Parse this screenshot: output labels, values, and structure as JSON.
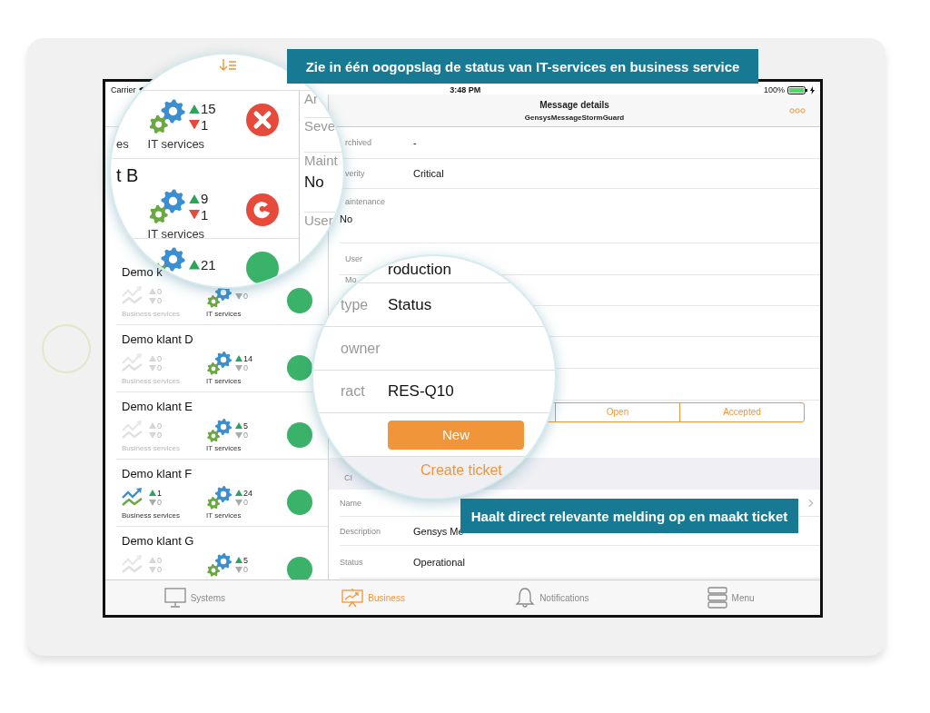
{
  "callouts": [
    "Zie in één oogopslag de status van IT-services en business service",
    "Haalt direct relevante melding op en maakt ticket"
  ],
  "status_bar": {
    "carrier": "Carrier",
    "time": "3:48 PM",
    "battery": "100%"
  },
  "clients": [
    {
      "name": "Demo k",
      "kind": "ok",
      "business": {
        "active": false,
        "up": "0",
        "down": "0",
        "down_alert": false,
        "label": "Business services"
      },
      "it": {
        "active": true,
        "down": "0",
        "down_alert": false,
        "label": "IT services"
      }
    },
    {
      "name": "Demo klant D",
      "kind": "ok",
      "business": {
        "active": false,
        "up": "0",
        "down": "0",
        "down_alert": false,
        "label": "Business services"
      },
      "it": {
        "active": true,
        "up": "14",
        "down": "0",
        "down_alert": false,
        "label": "IT services"
      }
    },
    {
      "name": "Demo klant E",
      "kind": "ok",
      "business": {
        "active": false,
        "up": "0",
        "down": "0",
        "down_alert": false,
        "label": "Business services"
      },
      "it": {
        "active": true,
        "up": "5",
        "down": "0",
        "down_alert": false,
        "label": "IT services"
      }
    },
    {
      "name": "Demo klant F",
      "kind": "ok",
      "business": {
        "active": true,
        "up": "1",
        "down": "0",
        "down_alert": false,
        "label": "Business services"
      },
      "it": {
        "active": true,
        "up": "24",
        "down": "0",
        "down_alert": false,
        "label": "IT services"
      }
    },
    {
      "name": "Demo klant G",
      "kind": "ok",
      "business": {
        "active": false,
        "up": "0",
        "down": "0",
        "down_alert": false
      },
      "it": {
        "active": true,
        "up": "5",
        "down": "0",
        "down_alert": false
      }
    }
  ],
  "detail": {
    "title": "Message details",
    "subtitle": "GensysMessageStormGuard",
    "fields": [
      {
        "kind": "inline",
        "label": "rchived",
        "value": "-"
      },
      {
        "kind": "inline",
        "label": "verity",
        "value": "Critical"
      },
      {
        "kind": "stacked",
        "label": "aintenance",
        "value": "No"
      },
      {
        "kind": "inline",
        "label": "User"
      },
      {
        "kind": "top",
        "label": "Mo"
      },
      {
        "kind": "blank"
      },
      {
        "kind": "blank"
      },
      {
        "kind": "blank"
      }
    ],
    "ticket_states": [
      {
        "label": "Open",
        "selected": false
      },
      {
        "label": "Accepted",
        "selected": false
      }
    ],
    "ci": {
      "header": "CI",
      "fields": [
        {
          "label": "Name",
          "link": true
        },
        {
          "label": "Description",
          "value": "Gensys Me",
          "link": false
        },
        {
          "label": "Status",
          "value": "Operational",
          "link": false
        }
      ]
    }
  },
  "lens_overview": {
    "rows": [
      {
        "business_label": "es",
        "it": {
          "up": "15",
          "down": "1",
          "down_alert": true,
          "label": "IT services"
        },
        "kind": "error"
      },
      {
        "name": "t B",
        "it": {
          "up": "9",
          "down": "1",
          "down_alert": true,
          "label": "IT services"
        },
        "kind": "warning"
      },
      {
        "it": {
          "up": "21"
        },
        "kind": "ok"
      }
    ],
    "detail_rows": [
      {
        "label": "Ar"
      },
      {
        "label": "Seve"
      },
      {
        "label": "Maint",
        "value": "No"
      },
      {
        "label": "User"
      }
    ]
  },
  "lens_ticket": {
    "rows": [
      {
        "value": "roduction"
      },
      {
        "label": "type",
        "value": "Status"
      },
      {
        "label": "owner"
      },
      {
        "label": "ract",
        "value": "RES-Q10"
      }
    ],
    "state": {
      "label": "New",
      "selected": true
    },
    "action": "Create ticket"
  },
  "tabs": [
    {
      "label": "Systems",
      "kind": "monitor",
      "selected": false
    },
    {
      "label": "Business",
      "kind": "chart",
      "selected": true
    },
    {
      "label": "Notifications",
      "kind": "bell",
      "selected": false
    },
    {
      "label": "Menu",
      "kind": "server",
      "selected": false
    }
  ]
}
